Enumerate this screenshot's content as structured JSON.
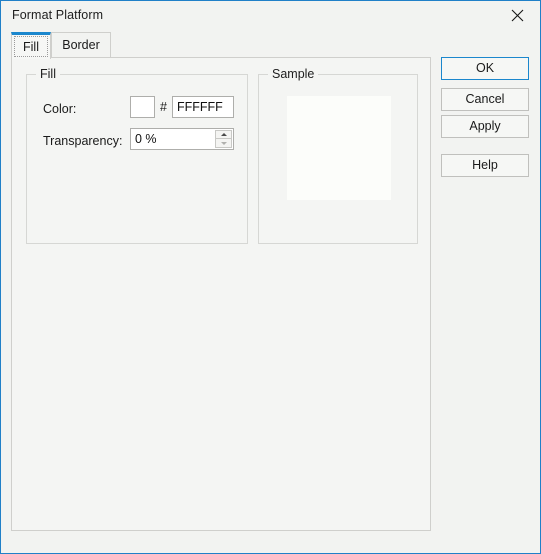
{
  "window": {
    "title": "Format Platform",
    "close_icon": "close-icon",
    "accent_color": "#1b87cd",
    "background_color": "#f2f3f1"
  },
  "tabs": [
    {
      "label": "Fill",
      "selected": true
    },
    {
      "label": "Border",
      "selected": false
    }
  ],
  "fill_tab": {
    "fill_group": {
      "legend": "Fill",
      "color": {
        "label": "Color:",
        "swatch_color": "#FFFFFF",
        "hash": "#",
        "hex_value": "FFFFFF"
      },
      "transparency": {
        "label": "Transparency:",
        "value": "0 %",
        "spinner_up_icon": "arrow-up-icon",
        "spinner_down_icon": "arrow-down-icon"
      }
    },
    "sample_group": {
      "legend": "Sample",
      "preview_color": "#FCFDFA"
    }
  },
  "buttons": {
    "ok": "OK",
    "cancel": "Cancel",
    "apply": "Apply",
    "help": "Help"
  }
}
